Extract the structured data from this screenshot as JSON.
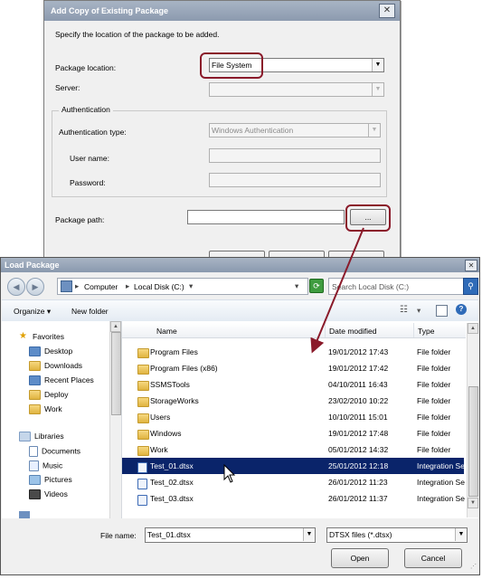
{
  "dialog1": {
    "title": "Add Copy of Existing Package",
    "close_glyph": "✕",
    "instruction": "Specify the location of the package to be added.",
    "package_location_label": "Package location:",
    "package_location_value": "File System",
    "server_label": "Server:",
    "server_value": "",
    "auth_group_title": "Authentication",
    "auth_type_label": "Authentication type:",
    "auth_type_value": "Windows Authentication",
    "username_label": "User name:",
    "password_label": "Password:",
    "package_path_label": "Package path:",
    "package_path_value": "",
    "browse_label": "..."
  },
  "dialog2": {
    "title": "Load Package",
    "close_glyph": "✕",
    "breadcrumb": [
      "Computer",
      "Local Disk (C:)"
    ],
    "search_placeholder": "Search Local Disk (C:)",
    "organize_label": "Organize ▾",
    "new_folder_label": "New folder",
    "nav": {
      "favorites_label": "Favorites",
      "favorites": [
        "Desktop",
        "Downloads",
        "Recent Places",
        "Deploy",
        "Work"
      ],
      "libraries_label": "Libraries",
      "libraries": [
        "Documents",
        "Music",
        "Pictures",
        "Videos"
      ]
    },
    "columns": {
      "name": "Name",
      "date": "Date modified",
      "type": "Type"
    },
    "files": [
      {
        "name": "Program Files",
        "date": "19/01/2012 17:43",
        "type": "File folder",
        "icon": "folder-icon"
      },
      {
        "name": "Program Files (x86)",
        "date": "19/01/2012 17:42",
        "type": "File folder",
        "icon": "folder-icon"
      },
      {
        "name": "SSMSTools",
        "date": "04/10/2011 16:43",
        "type": "File folder",
        "icon": "folder-icon"
      },
      {
        "name": "StorageWorks",
        "date": "23/02/2010 10:22",
        "type": "File folder",
        "icon": "folder-icon"
      },
      {
        "name": "Users",
        "date": "10/10/2011 15:01",
        "type": "File folder",
        "icon": "folder-icon"
      },
      {
        "name": "Windows",
        "date": "19/01/2012 17:48",
        "type": "File folder",
        "icon": "folder-icon"
      },
      {
        "name": "Work",
        "date": "05/01/2012 14:32",
        "type": "File folder",
        "icon": "folder-icon"
      },
      {
        "name": "Test_01.dtsx",
        "date": "25/01/2012 12:18",
        "type": "Integration Se",
        "icon": "dtsx-file-icon",
        "selected": true
      },
      {
        "name": "Test_02.dtsx",
        "date": "26/01/2012 11:23",
        "type": "Integration Se",
        "icon": "dtsx-file-icon"
      },
      {
        "name": "Test_03.dtsx",
        "date": "26/01/2012 11:37",
        "type": "Integration Se",
        "icon": "dtsx-file-icon"
      }
    ],
    "file_name_label": "File name:",
    "file_name_value": "Test_01.dtsx",
    "file_type_value": "DTSX files (*.dtsx)",
    "open_label": "Open",
    "cancel_label": "Cancel"
  },
  "colors": {
    "highlight": "#8a1a2a",
    "selection": "#0a246a",
    "titlebar": "#9aa7ba"
  }
}
